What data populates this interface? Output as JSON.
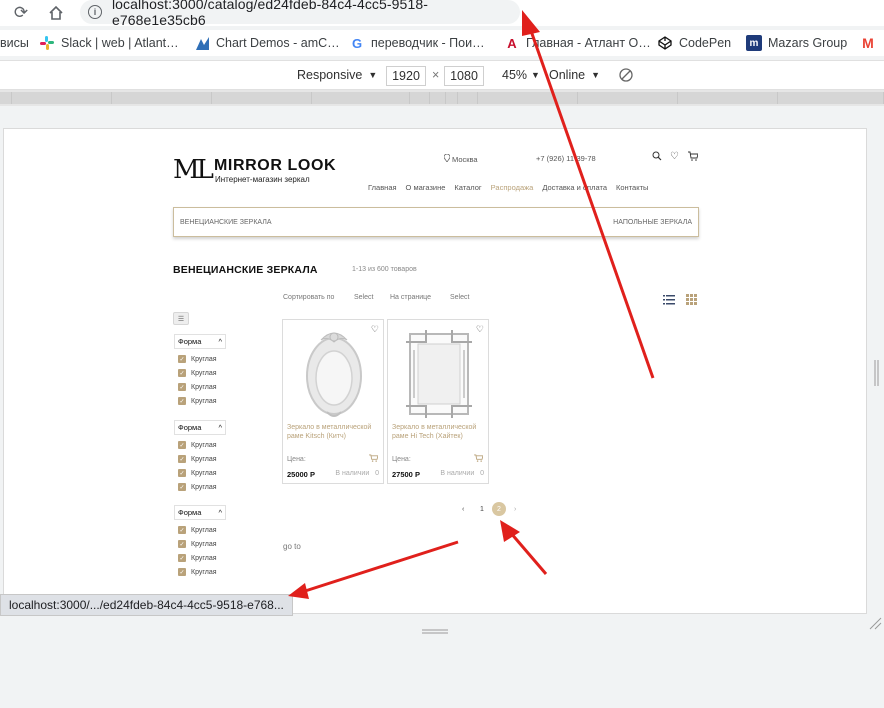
{
  "browser": {
    "url": "localhost:3000/catalog/ed24fdeb-84c4-4cc5-9518-e768e1e35cb6",
    "bookmarks": [
      {
        "label": "висы",
        "icon": "none"
      },
      {
        "label": "Slack | web | Atlant…",
        "icon": "slack-icon"
      },
      {
        "label": "Chart Demos - amC…",
        "icon": "amcharts-icon"
      },
      {
        "label": "переводчик - Пои…",
        "icon": "google-icon"
      },
      {
        "label": "Главная - Атлант О…",
        "icon": "atlant-icon"
      },
      {
        "label": "CodePen",
        "icon": "codepen-icon"
      },
      {
        "label": "Mazars Group",
        "icon": "mazars-icon"
      },
      {
        "label": "M",
        "icon": "gmail-icon"
      }
    ],
    "status_url": "localhost:3000/.../ed24fdeb-84c4-4cc5-9518-e768..."
  },
  "devtools": {
    "device": "Responsive",
    "width": "1920",
    "height": "1080",
    "times": "×",
    "zoom": "45%",
    "network": "Online"
  },
  "site": {
    "logo_mark": "ML",
    "logo_name": "MIRROR LOOK",
    "logo_tagline": "Интернет-магазин зеркал",
    "city": "Москва",
    "phone": "+7 (926) 11-39-78",
    "nav": [
      "Главная",
      "О магазине",
      "Каталог",
      "Распродажа",
      "Доставка и оплата",
      "Контакты"
    ],
    "catbar_left": "ВЕНЕЦИАНСКИЕ ЗЕРКАЛА",
    "catbar_right": "НАПОЛЬНЫЕ ЗЕРКАЛА",
    "page_title": "ВЕНЕЦИАНСКИЕ ЗЕРКАЛА",
    "count": "1-13 из 600 товаров",
    "sort_label": "Сортировать по",
    "sort_value": "Select",
    "perpage_label": "На странице",
    "perpage_value": "Select",
    "filters": [
      {
        "title": "Форма",
        "options": [
          "Круглая",
          "Круглая",
          "Круглая",
          "Круглая"
        ]
      },
      {
        "title": "Форма",
        "options": [
          "Круглая",
          "Круглая",
          "Круглая",
          "Круглая"
        ]
      },
      {
        "title": "Форма",
        "options": [
          "Круглая",
          "Круглая",
          "Круглая",
          "Круглая"
        ]
      }
    ],
    "products": [
      {
        "title": "Зеркало в металлической раме Kitsch (Китч)",
        "price_label": "Цена:",
        "price": "25000 Р",
        "stock": "В наличии",
        "qty": "0"
      },
      {
        "title": "Зеркало в металлической раме Hi Tech (Хайтек)",
        "price_label": "Цена:",
        "price": "27500 Р",
        "stock": "В наличии",
        "qty": "0"
      }
    ],
    "pager": {
      "prev": "‹",
      "page1": "1",
      "page2": "2",
      "next": "›"
    },
    "goto": "go to"
  },
  "colors": {
    "accent": "#b9a27a",
    "annotation": "#e0201c"
  }
}
